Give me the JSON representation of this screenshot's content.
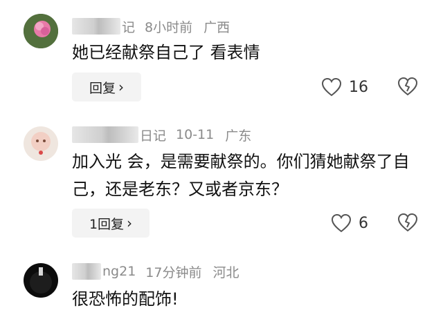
{
  "comments": [
    {
      "name_tail": "记",
      "time": "8小时前",
      "location": "广西",
      "text": "她已经献祭自己了 看表情",
      "reply_label": "回复",
      "likes": "16"
    },
    {
      "name_tail": "日记",
      "time": "10-11",
      "location": "广东",
      "text": "加入光 会，是需要献祭的。你们猜她献祭了自己，还是老东？又或者京东？",
      "reply_label": "1回复",
      "likes": "6"
    },
    {
      "name_tail": "ng21",
      "time": "17分钟前",
      "location": "河北",
      "text": "很恐怖的配饰!"
    }
  ],
  "icons": {
    "like": "heart-outline-icon",
    "dislike": "broken-heart-outline-icon",
    "reply_arrow": "chevron-right-icon"
  },
  "colors": {
    "meta_text": "#8a8a8a",
    "body_text": "#111111",
    "reply_bg": "#f3f3f3"
  }
}
